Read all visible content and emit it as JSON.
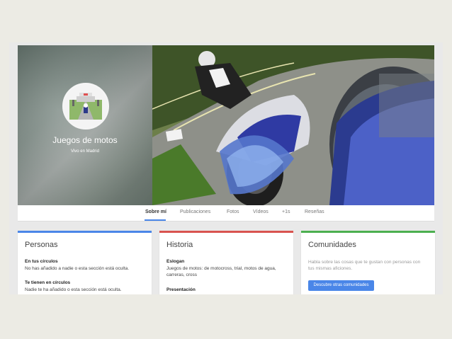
{
  "profile": {
    "name": "Juegos de motos",
    "location": "Vivo en Madrid"
  },
  "tabs": [
    {
      "label": "Sobre mí"
    },
    {
      "label": "Publicaciones"
    },
    {
      "label": "Fotos"
    },
    {
      "label": "Vídeos"
    },
    {
      "label": "+1s"
    },
    {
      "label": "Reseñas"
    }
  ],
  "cards": {
    "personas": {
      "title": "Personas",
      "accent": "#4a86e8",
      "sections": [
        {
          "title": "En tus círculos",
          "text": "No has añadido a nadie o esta sección está oculta."
        },
        {
          "title": "Te tienen en círculos",
          "text": "Nadie te ha añadido o esta sección está oculta."
        }
      ]
    },
    "historia": {
      "title": "Historia",
      "accent": "#d9534f",
      "sections": [
        {
          "title": "Eslogan",
          "text": "Juegos de motos: de motocross, trial, motos de agua, carreras, cross"
        },
        {
          "title": "Presentación",
          "text": ""
        }
      ]
    },
    "comunidades": {
      "title": "Comunidades",
      "accent": "#4caf50",
      "text": "Habla sobre las cosas que te gustan con personas con tus mismas aficiones.",
      "button": "Descubre otras comunidades"
    }
  }
}
